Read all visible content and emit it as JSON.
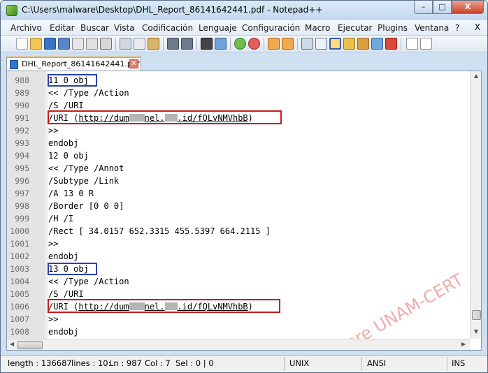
{
  "window": {
    "title": "C:\\Users\\malware\\Desktop\\DHL_Report_86141642441.pdf - Notepad++",
    "minimize": "–",
    "maximize": "□",
    "close": "X"
  },
  "menu": {
    "items": [
      "Archivo",
      "Editar",
      "Buscar",
      "Vista",
      "Codificación",
      "Lenguaje",
      "Configuración",
      "Macro",
      "Ejecutar",
      "Plugins",
      "Ventana",
      "?"
    ],
    "close_label": "X"
  },
  "tab": {
    "label": "DHL_Report_86141642441.pdf",
    "close_label": "✕"
  },
  "editor": {
    "lines": [
      {
        "num": "988",
        "text": "11 0 obj"
      },
      {
        "num": "989",
        "text": "<< /Type /Action"
      },
      {
        "num": "990",
        "text": "/S /URI"
      },
      {
        "num": "991",
        "pre": "/URI (",
        "url1": "http://dum",
        "url2": "nel.",
        "url3": ".id/fQLvNMVhbB",
        "post": ")"
      },
      {
        "num": "992",
        "text": ">>"
      },
      {
        "num": "993",
        "text": "endobj"
      },
      {
        "num": "994",
        "text": "12 0 obj"
      },
      {
        "num": "995",
        "text": "<< /Type /Annot"
      },
      {
        "num": "996",
        "text": "/Subtype /Link"
      },
      {
        "num": "997",
        "text": "/A 13 0 R"
      },
      {
        "num": "998",
        "text": "/Border [0 0 0]"
      },
      {
        "num": "999",
        "text": "/H /I"
      },
      {
        "num": "1000",
        "text": "/Rect [ 34.0157 652.3315 455.5397 664.2115 ]"
      },
      {
        "num": "1001",
        "text": ">>"
      },
      {
        "num": "1002",
        "text": "endobj"
      },
      {
        "num": "1003",
        "text": "13 0 obj"
      },
      {
        "num": "1004",
        "text": "<< /Type /Action"
      },
      {
        "num": "1005",
        "text": "/S /URI"
      },
      {
        "num": "1006",
        "pre": "/URI (",
        "url1": "http://dum",
        "url2": "nel.",
        "url3": ".id/fQLvNMVhbB",
        "post": ")"
      },
      {
        "num": "1007",
        "text": ">>"
      },
      {
        "num": "1008",
        "text": "endobj"
      }
    ]
  },
  "watermark": "Malware UNAM-CERT",
  "status": {
    "length": "length : 136687",
    "lines": "lines : 10:",
    "ln": "Ln : 987",
    "col": "Col : 7",
    "sel": "Sel : 0 | 0",
    "eol": "UNIX",
    "encoding": "ANSI",
    "mode": "INS"
  },
  "colors": {
    "annotation_blue": "#2a3fb4",
    "annotation_red": "#d01a1a",
    "watermark": "#e86464",
    "tab_accent": "#f4a31f"
  }
}
